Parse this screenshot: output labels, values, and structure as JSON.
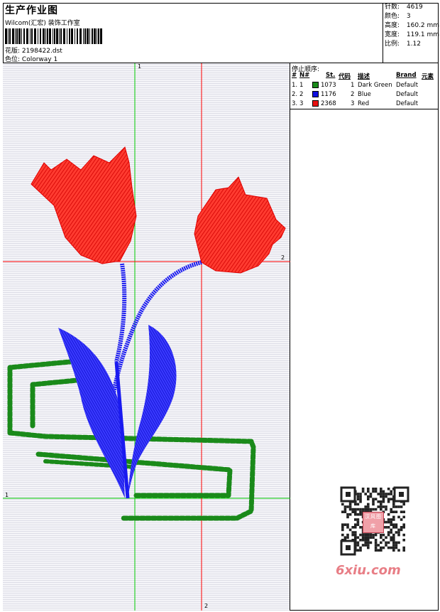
{
  "header": {
    "title": "生产作业图",
    "subtitle": "Wilcom(汇宏) 装饰工作室",
    "design_label": "花版:",
    "design_value": "2198422.dst",
    "colorway_label": "色位:",
    "colorway_value": "Colorway 1"
  },
  "stats": [
    {
      "label": "针数:",
      "value": "4619"
    },
    {
      "label": "颜色:",
      "value": "3"
    },
    {
      "label": "高度:",
      "value": "160.2 mm"
    },
    {
      "label": "宽度:",
      "value": "119.1 mm"
    },
    {
      "label": "比例:",
      "value": "1.12"
    }
  ],
  "stop_sequence": {
    "title": "停止顺序:",
    "headers": [
      "#",
      "N#",
      "St.",
      "代码",
      "描述",
      "Brand",
      "元素"
    ],
    "rows": [
      {
        "index": "1.",
        "n": "1",
        "color": "#1a8a1a",
        "stitches": "1073",
        "code": "1",
        "description": "Dark Green",
        "brand": "Default"
      },
      {
        "index": "2.",
        "n": "2",
        "color": "#1010e0",
        "stitches": "1176",
        "code": "2",
        "description": "Blue",
        "brand": "Default"
      },
      {
        "index": "3.",
        "n": "3",
        "color": "#e81010",
        "stitches": "2368",
        "code": "3",
        "description": "Red",
        "brand": "Default"
      }
    ]
  },
  "axes": {
    "green_top": "1",
    "green_left": "1",
    "red_right": "2",
    "red_bottom": "2"
  },
  "watermark": {
    "brand_text": "6xiu.com",
    "stamp_text": "汉风图库"
  }
}
